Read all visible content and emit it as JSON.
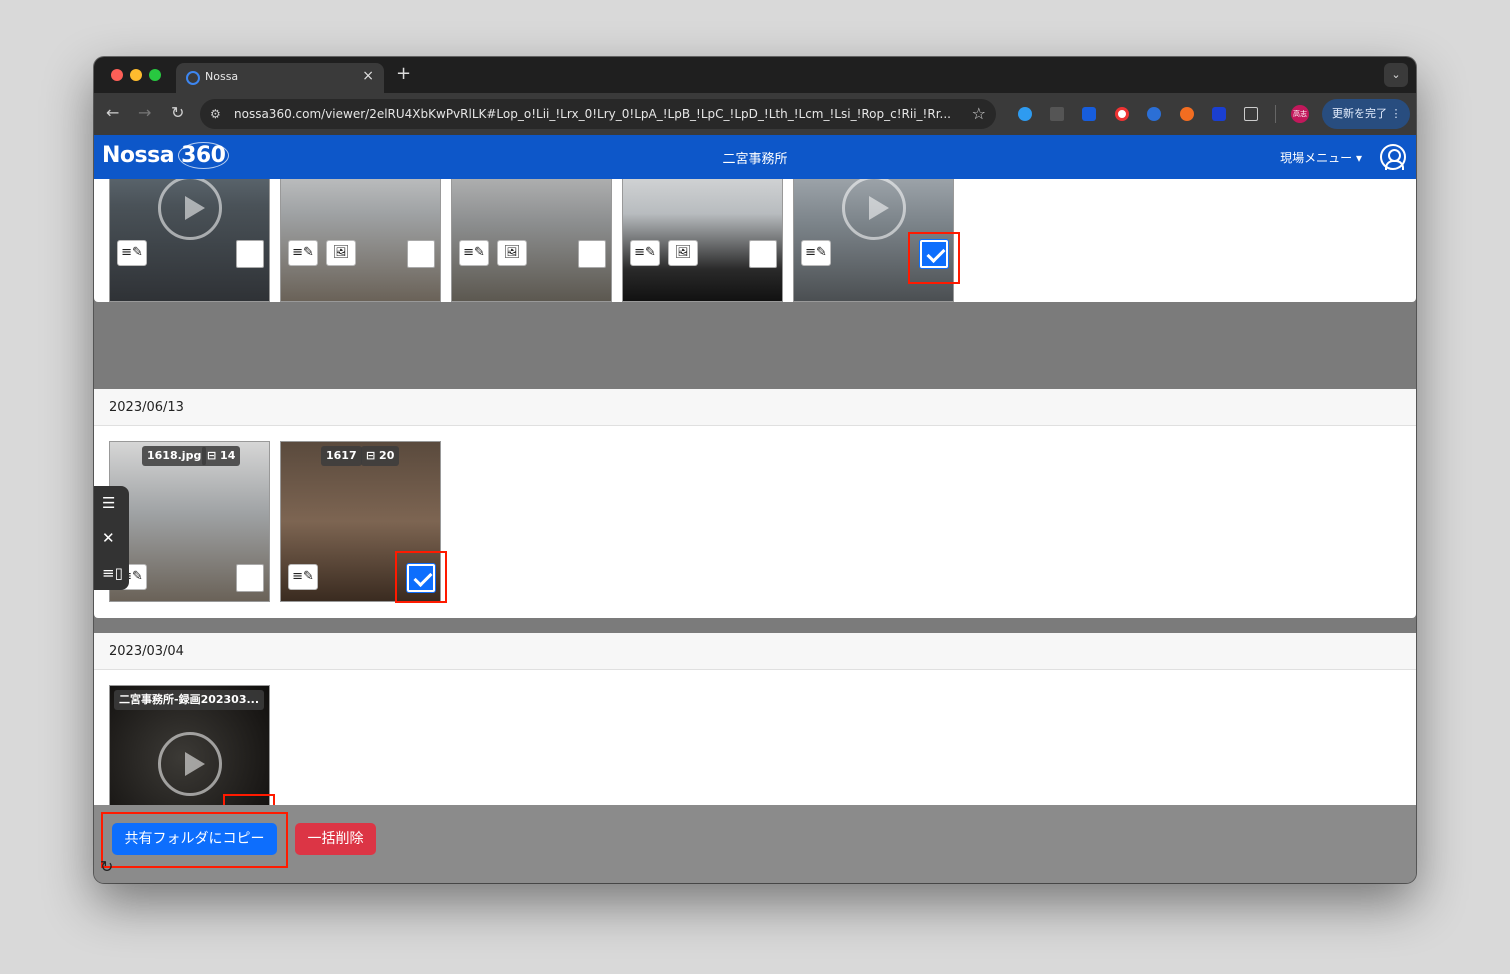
{
  "browser": {
    "tab_title": "Nossa",
    "tab_close": "×",
    "new_tab": "+",
    "tab_search": "⌄",
    "url": "nossa360.com/viewer/2elRU4XbKwPvRlLK#Lop_o!Lii_!Lrx_0!Lry_0!LpA_!LpB_!LpC_!LpD_!Lth_!Lcm_!Lsi_!Rop_c!Rii_!Rr...",
    "profile_initials": "高志",
    "update_button": "更新を完了 ⋮"
  },
  "app": {
    "logo_text": "Nossa",
    "logo_num": "360",
    "site_title": "二宮事務所",
    "site_menu": "現場メニュー ▾"
  },
  "sections": [
    {
      "date": "2023/06/13",
      "thumbs": [
        {
          "label": "1618.jpg",
          "count": "14",
          "checked": false
        },
        {
          "label": "1617",
          "count": "20",
          "checked": true
        }
      ]
    },
    {
      "date": "2023/03/04",
      "thumbs": [
        {
          "label": "二宮事務所-録画202303...",
          "checked": true
        }
      ]
    }
  ],
  "actions": {
    "copy_button": "共有フォルダにコピー",
    "delete_button": "一括削除"
  },
  "icons": {
    "memo": "≡✎",
    "image": "🖼",
    "list": "☰",
    "close": "✕",
    "panel": "≡▯",
    "refresh": "↻"
  }
}
